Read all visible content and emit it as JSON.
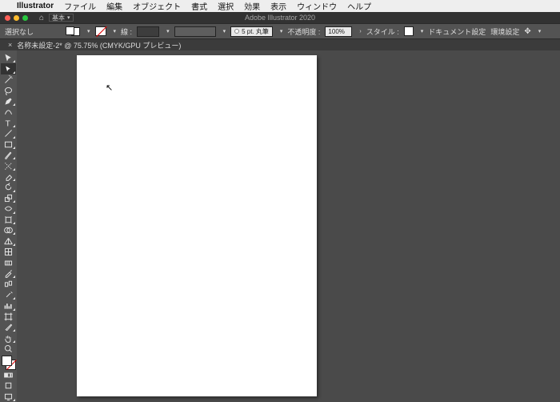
{
  "menubar": {
    "apple": "",
    "app": "Illustrator",
    "items": [
      "ファイル",
      "編集",
      "オブジェクト",
      "書式",
      "選択",
      "効果",
      "表示",
      "ウィンドウ",
      "ヘルプ"
    ]
  },
  "window": {
    "title": "Adobe Illustrator 2020",
    "layout_label": "基本"
  },
  "control": {
    "selection": "選択なし",
    "stroke_label": "線 :",
    "stroke_profile": "5 pt. 丸筆",
    "opacity_label": "不透明度 :",
    "opacity_value": "100%",
    "style_label": "スタイル :",
    "doc_setup": "ドキュメント設定",
    "prefs": "環境設定"
  },
  "doc_tab": {
    "label": "名称未設定-2* @ 75.75% (CMYK/GPU プレビュー)"
  },
  "tools": [
    "selection-tool",
    "direct-selection-tool",
    "magic-wand-tool",
    "lasso-tool",
    "pen-tool",
    "curvature-tool",
    "type-tool",
    "line-tool",
    "rectangle-tool",
    "paintbrush-tool",
    "shaper-tool",
    "eraser-tool",
    "rotate-tool",
    "scale-tool",
    "width-tool",
    "free-transform-tool",
    "shape-builder-tool",
    "perspective-grid-tool",
    "mesh-tool",
    "gradient-tool",
    "eyedropper-tool",
    "blend-tool",
    "symbol-sprayer-tool",
    "column-graph-tool",
    "artboard-tool",
    "slice-tool",
    "hand-tool",
    "zoom-tool"
  ]
}
